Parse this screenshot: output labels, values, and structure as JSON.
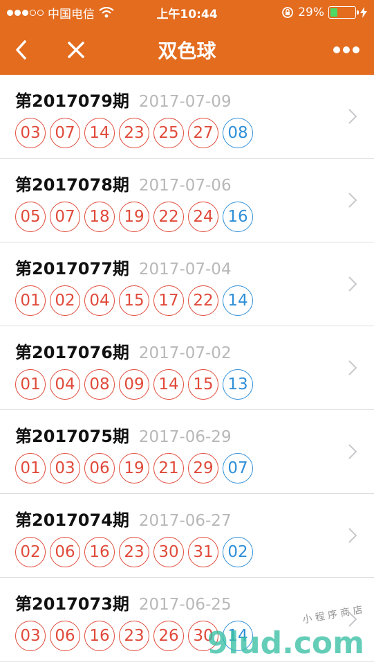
{
  "status": {
    "carrier": "中国电信",
    "time": "上午10:44",
    "battery": "29%",
    "battery_level": 0.29,
    "colors": {
      "battery": "#4cd964"
    }
  },
  "nav": {
    "title": "双色球",
    "back_icon": "chevron-left-icon",
    "close_icon": "close-icon",
    "more_icon": "more-icon",
    "color": "#e36c1f"
  },
  "draws": [
    {
      "issue": "第2017079期",
      "date": "2017-07-09",
      "red": [
        "03",
        "07",
        "14",
        "23",
        "25",
        "27"
      ],
      "blue": "08"
    },
    {
      "issue": "第2017078期",
      "date": "2017-07-06",
      "red": [
        "05",
        "07",
        "18",
        "19",
        "22",
        "24"
      ],
      "blue": "16"
    },
    {
      "issue": "第2017077期",
      "date": "2017-07-04",
      "red": [
        "01",
        "02",
        "04",
        "15",
        "17",
        "22"
      ],
      "blue": "14"
    },
    {
      "issue": "第2017076期",
      "date": "2017-07-02",
      "red": [
        "01",
        "04",
        "08",
        "09",
        "14",
        "15"
      ],
      "blue": "13"
    },
    {
      "issue": "第2017075期",
      "date": "2017-06-29",
      "red": [
        "01",
        "03",
        "06",
        "19",
        "21",
        "29"
      ],
      "blue": "07"
    },
    {
      "issue": "第2017074期",
      "date": "2017-06-27",
      "red": [
        "02",
        "06",
        "16",
        "23",
        "30",
        "31"
      ],
      "blue": "02"
    },
    {
      "issue": "第2017073期",
      "date": "2017-06-25",
      "red": [
        "03",
        "06",
        "16",
        "23",
        "26",
        "30"
      ],
      "blue": "14"
    }
  ],
  "watermark": {
    "main": "9lud.com",
    "sub": "小 程 序 商 店"
  },
  "colors": {
    "red_ball": "#e04a3a",
    "blue_ball": "#2f8fd8"
  }
}
